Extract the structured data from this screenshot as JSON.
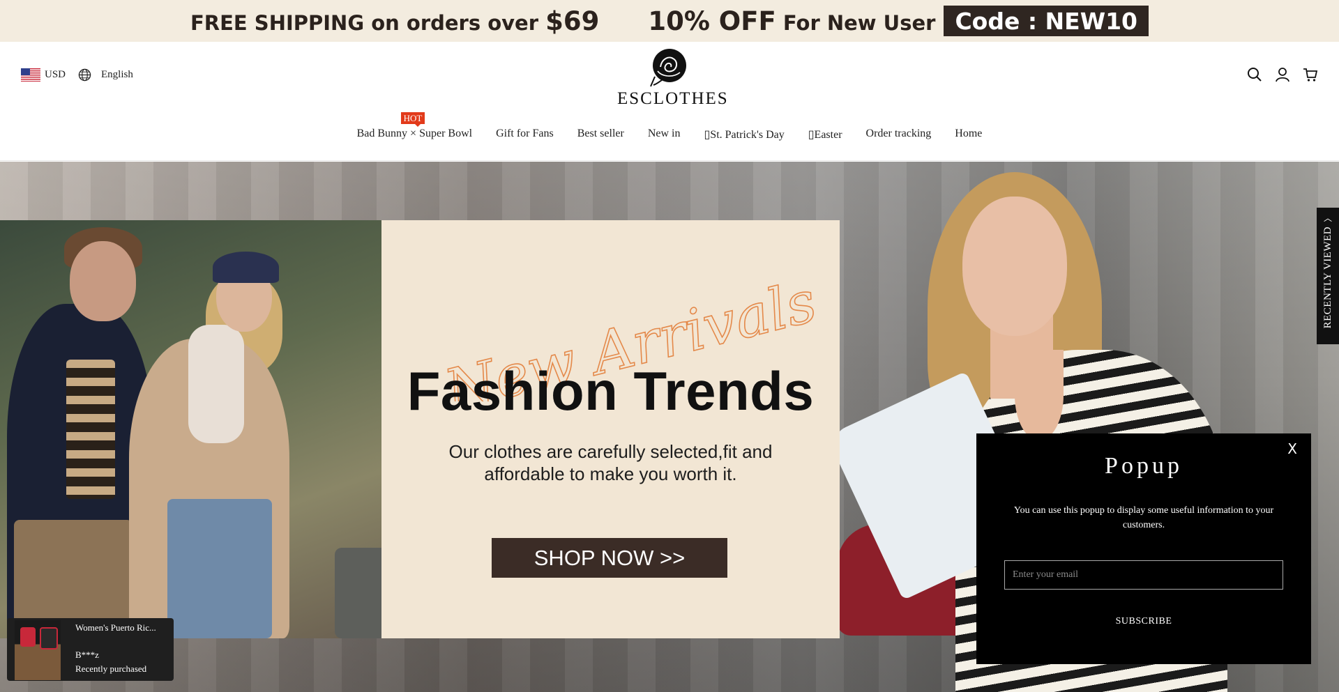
{
  "announcement": {
    "shipping_prefix": "FREE SHIPPING on orders over ",
    "shipping_amount": "$69",
    "discount_percent": "10% OFF",
    "discount_suffix": " For New User",
    "code_label": "Code : NEW10"
  },
  "header": {
    "currency": "USD",
    "language": "English",
    "brand": "ESCLOTHES",
    "icons": [
      "search-icon",
      "account-icon",
      "cart-icon"
    ]
  },
  "nav": {
    "hot_badge": "HOT",
    "items": [
      "Bad Bunny × Super Bowl",
      "Gift for Fans",
      "Best seller",
      "New in",
      "St. Patrick's Day",
      "Easter",
      "Order tracking",
      "Home"
    ]
  },
  "hero": {
    "script_text": "New Arrivals",
    "title": "Fashion Trends",
    "subtitle": "Our clothes are carefully selected,fit and affordable to make you worth it.",
    "cta": "SHOP NOW >>"
  },
  "recently_viewed": {
    "label": "RECENTLY VIEWED"
  },
  "popup": {
    "close": "X",
    "title": "Popup",
    "description": "You can use this popup to display some useful information to your customers.",
    "email_placeholder": "Enter your email",
    "subscribe": "SUBSCRIBE"
  },
  "toast": {
    "product": "Women's Puerto Ric...",
    "user": "B***z",
    "status": "Recently purchased"
  },
  "colors": {
    "announcement_bg": "#f3ecdf",
    "code_bg": "#2f2621",
    "hot": "#e23a1a",
    "promo_bg": "#f2e6d4",
    "script": "#e4894a",
    "cta_bg": "#3b2c26"
  }
}
